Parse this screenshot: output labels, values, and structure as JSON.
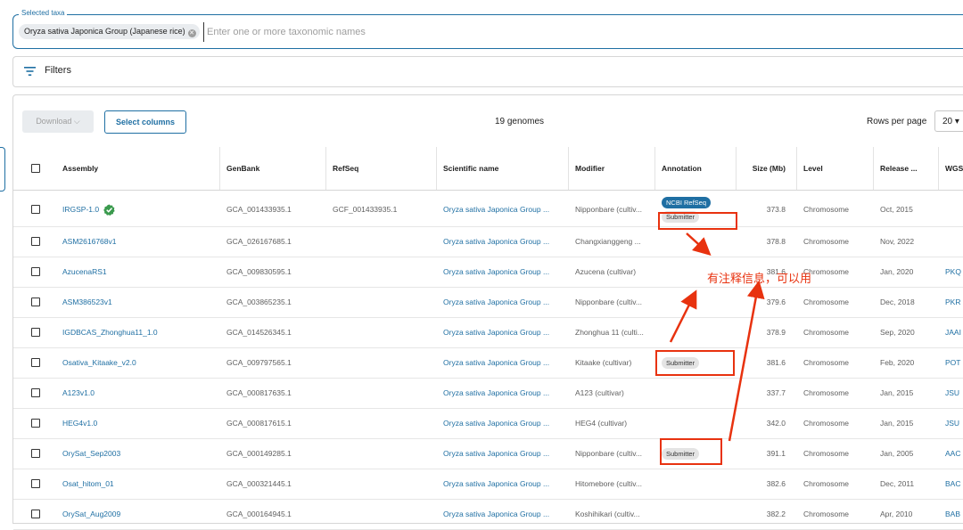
{
  "taxa": {
    "legend": "Selected taxa",
    "chip_label": "Oryza sativa Japonica Group (Japanese rice)",
    "input_placeholder": "Enter one or more taxonomic names"
  },
  "filters": {
    "label": "Filters"
  },
  "toolbar": {
    "download_label": "Download",
    "select_columns_label": "Select columns",
    "genome_count": "19 genomes",
    "rows_per_page_label": "Rows per page",
    "rows_per_page_value": "20"
  },
  "columns": [
    "Assembly",
    "GenBank",
    "RefSeq",
    "Scientific name",
    "Modifier",
    "Annotation",
    "Size (Mb)",
    "Level",
    "Release ...",
    "WGS"
  ],
  "rows": [
    {
      "assembly": "IRGSP-1.0",
      "verified": true,
      "genbank": "GCA_001433935.1",
      "refseq": "GCF_001433935.1",
      "sci": "Oryza sativa Japonica Group ...",
      "modifier": "Nipponbare (cultiv...",
      "annotation": [
        "NCBI RefSeq",
        "Submitter"
      ],
      "size": "373.8",
      "level": "Chromosome",
      "release": "Oct, 2015",
      "wgs": ""
    },
    {
      "assembly": "ASM2616768v1",
      "verified": false,
      "genbank": "GCA_026167685.1",
      "refseq": "",
      "sci": "Oryza sativa Japonica Group ...",
      "modifier": "Changxianggeng ...",
      "annotation": [],
      "size": "378.8",
      "level": "Chromosome",
      "release": "Nov, 2022",
      "wgs": ""
    },
    {
      "assembly": "AzucenaRS1",
      "verified": false,
      "genbank": "GCA_009830595.1",
      "refseq": "",
      "sci": "Oryza sativa Japonica Group ...",
      "modifier": "Azucena (cultivar)",
      "annotation": [],
      "size": "381.6",
      "level": "Chromosome",
      "release": "Jan, 2020",
      "wgs": "PKQ"
    },
    {
      "assembly": "ASM386523v1",
      "verified": false,
      "genbank": "GCA_003865235.1",
      "refseq": "",
      "sci": "Oryza sativa Japonica Group ...",
      "modifier": "Nipponbare (cultiv...",
      "annotation": [],
      "size": "379.6",
      "level": "Chromosome",
      "release": "Dec, 2018",
      "wgs": "PKR"
    },
    {
      "assembly": "IGDBCAS_Zhonghua11_1.0",
      "verified": false,
      "genbank": "GCA_014526345.1",
      "refseq": "",
      "sci": "Oryza sativa Japonica Group ...",
      "modifier": "Zhonghua 11 (culti...",
      "annotation": [],
      "size": "378.9",
      "level": "Chromosome",
      "release": "Sep, 2020",
      "wgs": "JAAI"
    },
    {
      "assembly": "Osativa_Kitaake_v2.0",
      "verified": false,
      "genbank": "GCA_009797565.1",
      "refseq": "",
      "sci": "Oryza sativa Japonica Group ...",
      "modifier": "Kitaake (cultivar)",
      "annotation": [
        "Submitter"
      ],
      "size": "381.6",
      "level": "Chromosome",
      "release": "Feb, 2020",
      "wgs": "POT"
    },
    {
      "assembly": "A123v1.0",
      "verified": false,
      "genbank": "GCA_000817635.1",
      "refseq": "",
      "sci": "Oryza sativa Japonica Group ...",
      "modifier": "A123 (cultivar)",
      "annotation": [],
      "size": "337.7",
      "level": "Chromosome",
      "release": "Jan, 2015",
      "wgs": "JSU"
    },
    {
      "assembly": "HEG4v1.0",
      "verified": false,
      "genbank": "GCA_000817615.1",
      "refseq": "",
      "sci": "Oryza sativa Japonica Group ...",
      "modifier": "HEG4 (cultivar)",
      "annotation": [],
      "size": "342.0",
      "level": "Chromosome",
      "release": "Jan, 2015",
      "wgs": "JSU"
    },
    {
      "assembly": "OrySat_Sep2003",
      "verified": false,
      "genbank": "GCA_000149285.1",
      "refseq": "",
      "sci": "Oryza sativa Japonica Group ...",
      "modifier": "Nipponbare (cultiv...",
      "annotation": [
        "Submitter"
      ],
      "size": "391.1",
      "level": "Chromosome",
      "release": "Jan, 2005",
      "wgs": "AAC"
    },
    {
      "assembly": "Osat_hitom_01",
      "verified": false,
      "genbank": "GCA_000321445.1",
      "refseq": "",
      "sci": "Oryza sativa Japonica Group ...",
      "modifier": "Hitomebore (cultiv...",
      "annotation": [],
      "size": "382.6",
      "level": "Chromosome",
      "release": "Dec, 2011",
      "wgs": "BAC"
    },
    {
      "assembly": "OrySat_Aug2009",
      "verified": false,
      "genbank": "GCA_000164945.1",
      "refseq": "",
      "sci": "Oryza sativa Japonica Group ...",
      "modifier": "Koshihikari (cultiv...",
      "annotation": [],
      "size": "382.2",
      "level": "Chromosome",
      "release": "Apr, 2010",
      "wgs": "BAB"
    }
  ],
  "annotation_note": "有注释信息，可以用",
  "colors": {
    "accent": "#1f6fa3",
    "annotation_red": "#e8320f",
    "verified_green": "#3a9a4d"
  }
}
